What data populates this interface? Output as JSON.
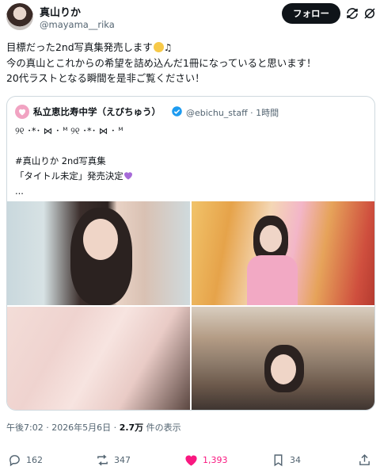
{
  "author": {
    "name": "真山りか",
    "handle": "@mayama__rika"
  },
  "header": {
    "follow_label": "フォロー",
    "icons": [
      "refresh-icon",
      "grok-icon"
    ]
  },
  "tweet": {
    "lines": [
      "目標だった2nd写真集発売します",
      "今の真山とこれからの希望を詰め込んだ1冊になっていると思います！",
      "20代ラストとなる瞬間を是非ご覧ください！"
    ],
    "emoji": "🙂",
    "music": "♫"
  },
  "quote": {
    "name": "私立恵比寿中学（えびちゅう）",
    "handle": "@ebichu_staff",
    "time": "· 1時間",
    "lines": [
      "୨୧ ･*･ ⋈ ･ ᴹ ୨୧ ･*･ ⋈ ･ ᴹ",
      "",
      "#真山りか  2nd写真集",
      "「タイトル未定」発売決定",
      "..."
    ]
  },
  "meta": {
    "time": "午後7:02 · 2026年5月6日 · ",
    "views": "2.7万",
    "views_suffix": " 件の表示"
  },
  "actions": {
    "replies": "162",
    "retweets": "347",
    "likes": "1,393",
    "bookmarks": "34"
  },
  "colors": {
    "like": "#f91880",
    "verified": "#1d9bf0",
    "follow_bg": "#0f1419"
  }
}
